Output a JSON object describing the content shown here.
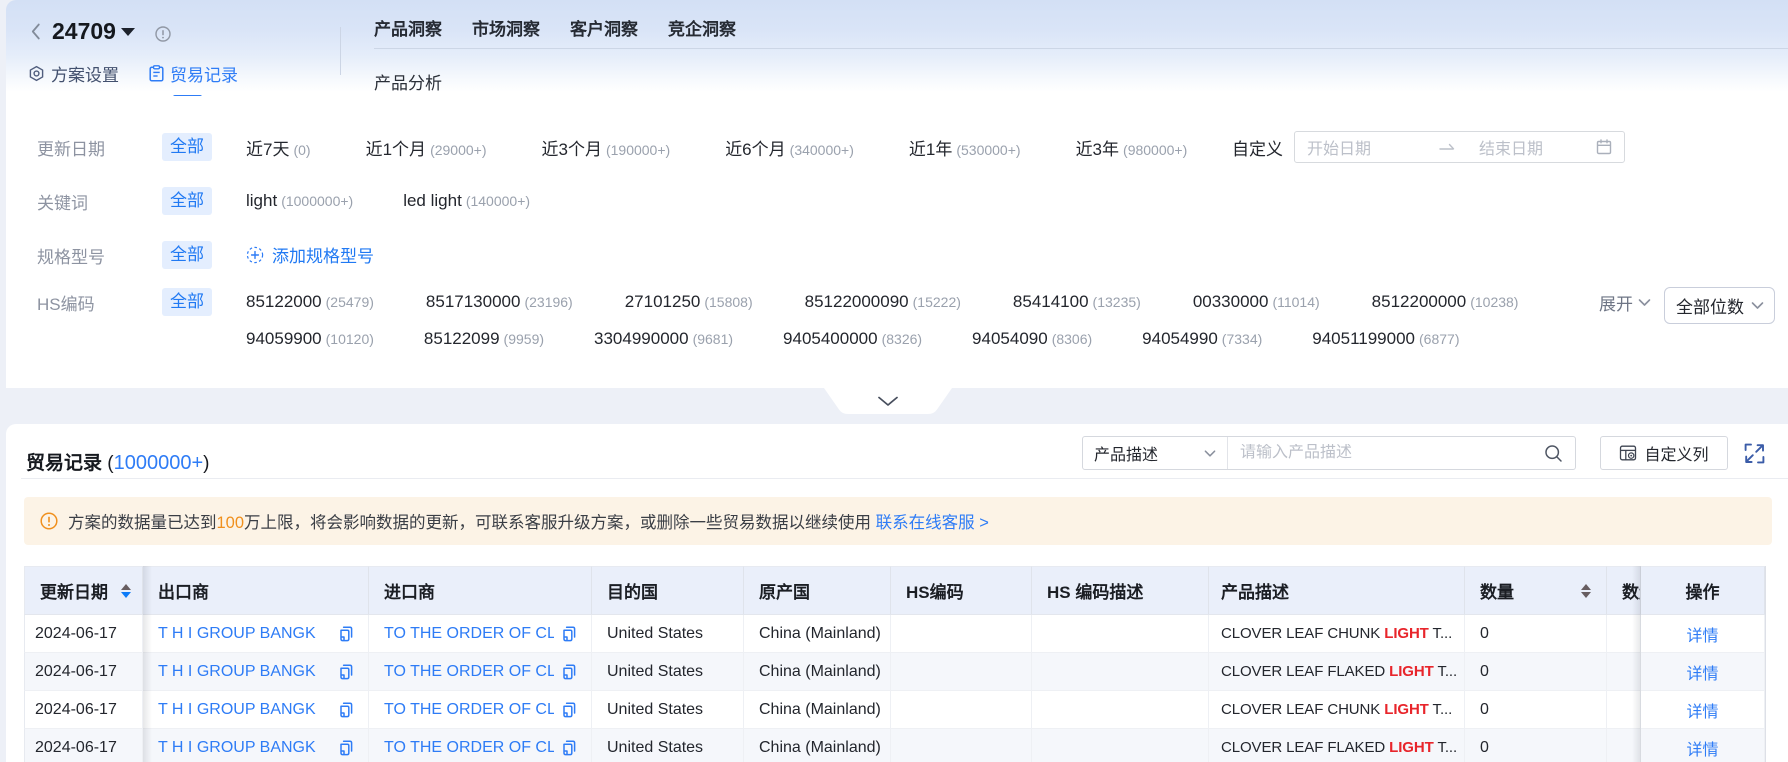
{
  "header": {
    "title": "24709",
    "tabs": [
      {
        "label": "方案设置"
      },
      {
        "label": "贸易记录"
      }
    ],
    "nav": [
      "产品洞察",
      "市场洞察",
      "客户洞察",
      "竞企洞察"
    ],
    "subnav": "产品分析"
  },
  "filters": {
    "date": {
      "label": "更新日期",
      "all": "全部",
      "options": [
        {
          "name": "近7天",
          "count": "(0)"
        },
        {
          "name": "近1个月",
          "count": "(29000+)"
        },
        {
          "name": "近3个月",
          "count": "(190000+)"
        },
        {
          "name": "近6个月",
          "count": "(340000+)"
        },
        {
          "name": "近1年",
          "count": "(530000+)"
        },
        {
          "name": "近3年",
          "count": "(980000+)"
        }
      ],
      "custom": "自定义",
      "start_placeholder": "开始日期",
      "end_placeholder": "结束日期"
    },
    "keyword": {
      "label": "关键词",
      "all": "全部",
      "options": [
        {
          "name": "light",
          "count": "(1000000+)"
        },
        {
          "name": "led light",
          "count": "(140000+)"
        }
      ]
    },
    "spec": {
      "label": "规格型号",
      "all": "全部",
      "add_label": "添加规格型号"
    },
    "hs": {
      "label": "HS编码",
      "all": "全部",
      "line1": [
        {
          "name": "85122000",
          "count": "(25479)"
        },
        {
          "name": "8517130000",
          "count": "(23196)"
        },
        {
          "name": "27101250",
          "count": "(15808)"
        },
        {
          "name": "85122000090",
          "count": "(15222)"
        },
        {
          "name": "85414100",
          "count": "(13235)"
        },
        {
          "name": "00330000",
          "count": "(11014)"
        },
        {
          "name": "8512200000",
          "count": "(10238)"
        }
      ],
      "line2": [
        {
          "name": "94059900",
          "count": "(10120)"
        },
        {
          "name": "85122099",
          "count": "(9959)"
        },
        {
          "name": "3304990000",
          "count": "(9681)"
        },
        {
          "name": "9405400000",
          "count": "(8326)"
        },
        {
          "name": "94054090",
          "count": "(8306)"
        },
        {
          "name": "94054990",
          "count": "(7334)"
        },
        {
          "name": "94051199000",
          "count": "(6877)"
        }
      ],
      "expand": "展开",
      "digits": "全部位数"
    }
  },
  "records": {
    "title": "贸易记录",
    "count_open": "(",
    "count": "1000000+",
    "count_close": ")",
    "toolbar": {
      "field_select": "产品描述",
      "search_placeholder": "请输入产品描述",
      "columns_button": "自定义列"
    },
    "banner": {
      "text_pre": "方案的数据量已达到",
      "highlight": "100",
      "text_post": "万上限，将会影响数据的更新，可联系客服升级方案，或删除一些贸易数据以继续使用",
      "link": "联系在线客服",
      "link_arrow": ">"
    }
  },
  "table": {
    "columns": {
      "date": "更新日期",
      "exporter": "出口商",
      "importer": "进口商",
      "dest": "目的国",
      "origin": "原产国",
      "hs": "HS编码",
      "hs_desc": "HS 编码描述",
      "desc": "产品描述",
      "qty": "数量",
      "qty_unit": "数量单位",
      "action": "操作"
    },
    "rows": [
      {
        "date": "2024-06-17",
        "exporter": "T H I GROUP BANGK",
        "importer": "TO THE ORDER OF CL",
        "dest": "United States",
        "origin": "China (Mainland)",
        "hs": "",
        "hs_desc": "",
        "desc_pre": "CLOVER LEAF CHUNK ",
        "desc_hl": "LIGHT",
        "desc_post": " T...",
        "qty": "0",
        "action": "详情"
      },
      {
        "date": "2024-06-17",
        "exporter": "T H I GROUP BANGK",
        "importer": "TO THE ORDER OF CL",
        "dest": "United States",
        "origin": "China (Mainland)",
        "hs": "",
        "hs_desc": "",
        "desc_pre": "CLOVER LEAF FLAKED ",
        "desc_hl": "LIGHT",
        "desc_post": " T...",
        "qty": "0",
        "action": "详情"
      },
      {
        "date": "2024-06-17",
        "exporter": "T H I GROUP BANGK",
        "importer": "TO THE ORDER OF CL",
        "dest": "United States",
        "origin": "China (Mainland)",
        "hs": "",
        "hs_desc": "",
        "desc_pre": "CLOVER LEAF CHUNK ",
        "desc_hl": "LIGHT",
        "desc_post": " T...",
        "qty": "0",
        "action": "详情"
      },
      {
        "date": "2024-06-17",
        "exporter": "T H I GROUP BANGK",
        "importer": "TO THE ORDER OF CL",
        "dest": "United States",
        "origin": "China (Mainland)",
        "hs": "",
        "hs_desc": "",
        "desc_pre": "CLOVER LEAF FLAKED ",
        "desc_hl": "LIGHT",
        "desc_post": " T...",
        "qty": "0",
        "action": "详情"
      }
    ]
  }
}
